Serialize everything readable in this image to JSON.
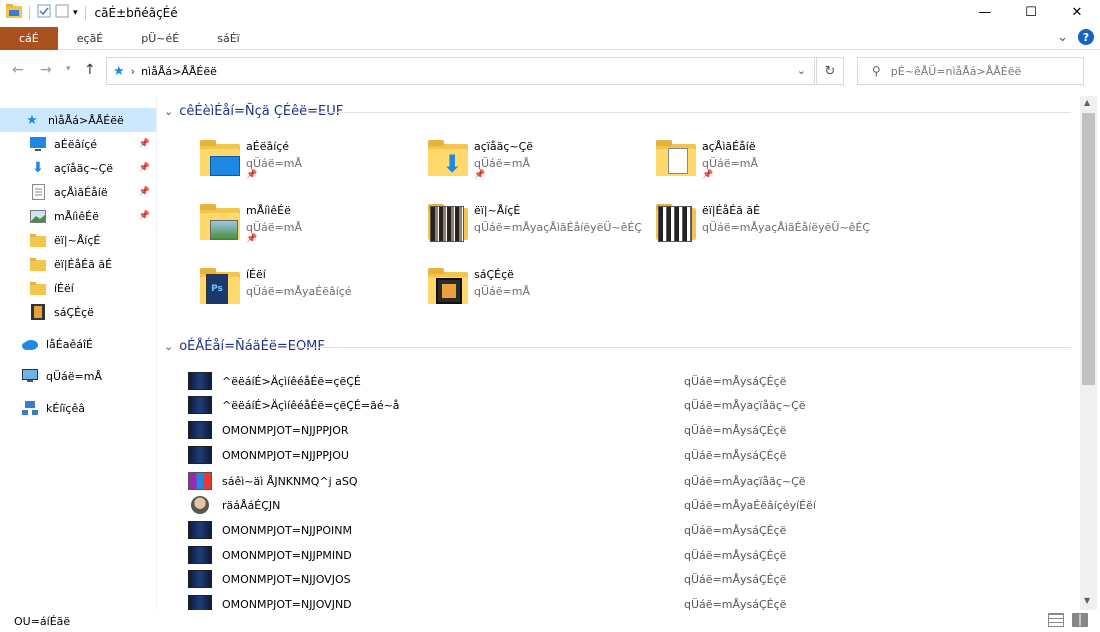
{
  "window": {
    "title": "cãÉ±bñéãçÉé",
    "minimize": "—",
    "maximize": "☐",
    "close": "✕"
  },
  "ribbon": {
    "tabs": [
      "cáÉ",
      "eçãÉ",
      "pÜ~éÉ",
      "sáÉï"
    ],
    "expand": "⌄",
    "help": "?"
  },
  "address": {
    "path": "nìåÅá>ÅÅÉëë",
    "search_placeholder": "pÉ~êÅÜ=nìåÅá>ÅÅÉëë"
  },
  "sidebar": {
    "items": [
      {
        "label": "nìåÅá>ÅÅÉëë",
        "icon": "star-icon",
        "pinned": false
      },
      {
        "label": "aÉëâíçé",
        "icon": "desktop-icon",
        "pinned": true
      },
      {
        "label": "açïåäç~Çë",
        "icon": "download-icon",
        "pinned": true
      },
      {
        "label": "açÅìãÉåíë",
        "icon": "documents-icon",
        "pinned": true
      },
      {
        "label": "mÅíìêÉë",
        "icon": "pictures-icon",
        "pinned": true
      },
      {
        "label": "ëï|~ÅíçÉ",
        "icon": "folder-icon",
        "pinned": false
      },
      {
        "label": "ëï|ÉåÉã ãÉ",
        "icon": "folder-icon",
        "pinned": false
      },
      {
        "label": "íÉëí",
        "icon": "folder-icon",
        "pinned": false
      },
      {
        "label": "sáÇÉçë",
        "icon": "videos-icon",
        "pinned": false
      },
      {
        "label": "låÉaêáîÉ",
        "icon": "cloud-icon",
        "pinned": false
      },
      {
        "label": "qÜáë=mÅ",
        "icon": "computer-icon",
        "pinned": false
      },
      {
        "label": "kÉíïçêâ",
        "icon": "network-icon",
        "pinned": false
      }
    ]
  },
  "frequent": {
    "header": "cêÉèìÉåí=Ñçä ÇÉêë=EUF",
    "tiles": [
      {
        "name": "aÉëâíçé",
        "sub": "qÜáë=mÅ",
        "icon": "desktop-folder-icon",
        "pinned": true
      },
      {
        "name": "açïåäç~Çë",
        "sub": "qÜáë=mÅ",
        "icon": "download-folder-icon",
        "pinned": true
      },
      {
        "name": "açÅìãÉåíë",
        "sub": "qÜáë=mÅ",
        "icon": "documents-folder-icon",
        "pinned": true
      },
      {
        "name": "mÅíìêÉë",
        "sub": "qÜáë=mÅ",
        "icon": "pictures-folder-icon",
        "pinned": true
      },
      {
        "name": "ëï|~ÅíçÉ",
        "sub": "qÜáë=mÅyaçÅìãÉåíëyëÜ~êÉÇ",
        "icon": "image-folder-icon",
        "pinned": false
      },
      {
        "name": "ëï|ÉåÉã ãÉ",
        "sub": "qÜáë=mÅyaçÅìãÉåíëyëÜ~êÉÇ",
        "icon": "image-folder-icon",
        "pinned": false
      },
      {
        "name": "íÉëí",
        "sub": "qÜáë=mÅyaÉëâíçé",
        "icon": "psd-folder-icon",
        "pinned": false
      },
      {
        "name": "sáÇÉçë",
        "sub": "qÜáë=mÅ",
        "icon": "video-folder-icon",
        "pinned": false
      }
    ]
  },
  "recent": {
    "header": "oÉÅÉåí=ÑáäÉë=EOMF",
    "files": [
      {
        "name": "^ëëáíÉ>ÄçìíêéåÉë=çëÇÉ",
        "location": "qÜáë=mÅysáÇÉçë",
        "icon": "video-file-icon"
      },
      {
        "name": "^ëëáíÉ>ÄçìíêéåÉë=çëÇÉ=ãé~å",
        "location": "qÜáë=mÅyaçïåäç~Çë",
        "icon": "video-file-icon"
      },
      {
        "name": "OMONMPJOT=NJJPPJOR",
        "location": "qÜáë=mÅysáÇÉçë",
        "icon": "video-file-icon"
      },
      {
        "name": "OMONMPJOT=NJJPPJOU",
        "location": "qÜáë=mÅysáÇÉçë",
        "icon": "video-file-icon"
      },
      {
        "name": "sáêì~äì ÅJNKNMQ^j aSQ",
        "location": "qÜáë=mÅyaçïåäç~Çë",
        "icon": "archive-file-icon"
      },
      {
        "name": "räáÅáÉÇJN",
        "location": "qÜáë=mÅyaÉëâíçéyíÉëí",
        "icon": "avatar-file-icon"
      },
      {
        "name": "OMONMPJOT=NJJPOINM",
        "location": "qÜáë=mÅysáÇÉçë",
        "icon": "video-file-icon"
      },
      {
        "name": "OMONMPJOT=NJJPMIND",
        "location": "qÜáë=mÅysáÇÉçë",
        "icon": "video-file-icon"
      },
      {
        "name": "OMONMPJOT=NJJOVJOS",
        "location": "qÜáë=mÅysáÇÉçë",
        "icon": "video-file-icon"
      },
      {
        "name": "OMONMPJOT=NJJOVJND",
        "location": "qÜáë=mÅysáÇÉçë",
        "icon": "video-file-icon"
      }
    ]
  },
  "status": {
    "text": "OU=áíÉãë"
  },
  "colors": {
    "file_tab": "#a9521f",
    "selected": "#cce8ff",
    "group_header": "#1e3287",
    "folder": "#f3c54f"
  }
}
